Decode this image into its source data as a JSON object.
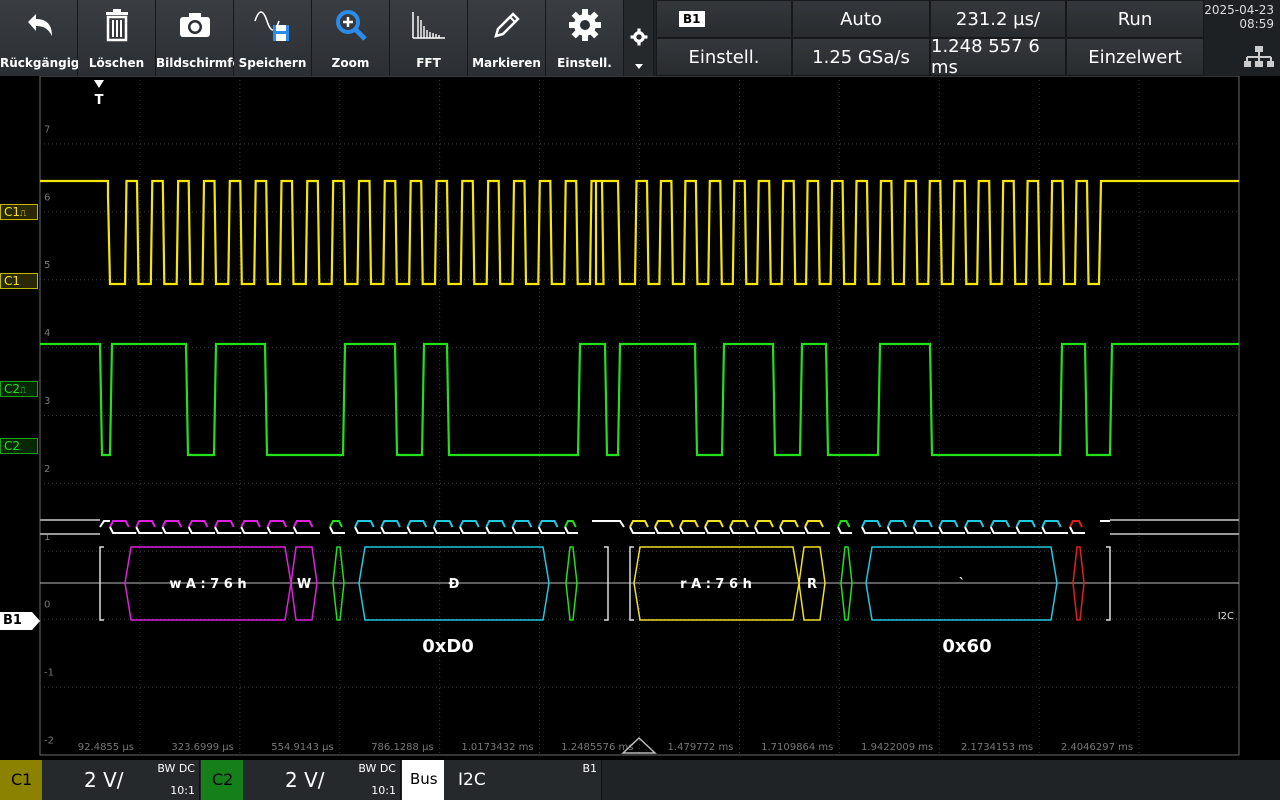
{
  "toolbar": {
    "buttons": [
      {
        "label": "Rückgängig",
        "icon": "undo-icon"
      },
      {
        "label": "Löschen",
        "icon": "trash-icon"
      },
      {
        "label": "Bildschirmfoto",
        "icon": "camera-icon"
      },
      {
        "label": "Speichern",
        "icon": "save-icon"
      },
      {
        "label": "Zoom",
        "icon": "zoom-icon"
      },
      {
        "label": "FFT",
        "icon": "fft-icon"
      },
      {
        "label": "Markieren",
        "icon": "pencil-icon"
      },
      {
        "label": "Einstell.",
        "icon": "gear-icon"
      }
    ],
    "settings_icon": "gear-small-icon"
  },
  "status": {
    "bus_badge": "B1",
    "bus_settings": "Einstell.",
    "trigger_mode": "Auto",
    "sample_rate": "1.25 GSa/s",
    "time_per_div": "231.2 µs/",
    "time_position": "1.248 557 6 ms",
    "run_state": "Run",
    "acq_mode": "Einzelwert",
    "date": "2025-04-23",
    "time": "08:59",
    "network_icon": "network-icon"
  },
  "grid": {
    "y_labels": [
      "7",
      "6",
      "5",
      "4",
      "3",
      "2",
      "1",
      "0",
      "-1",
      "-2"
    ],
    "x_labels": [
      "92.4855 µs",
      "323.6999 µs",
      "554.9143 µs",
      "786.1288 µs",
      "1.0173432 ms",
      "1.2485576 ms",
      "1.479772 ms",
      "1.7109864 ms",
      "1.9422009 ms",
      "2.1734153 ms",
      "2.4046297 ms"
    ],
    "trigger_marker": "T",
    "bus_protocol_tag": "I2C"
  },
  "channels": {
    "c1": {
      "label": "C1",
      "trig_label": "C1",
      "color": "#f5e60a"
    },
    "c2": {
      "label": "C2",
      "trig_label": "C2",
      "color": "#22e01a"
    },
    "b1": {
      "label": "B1"
    }
  },
  "decode": {
    "frames": [
      {
        "text": "w A : 7 6 h",
        "color": "#e020e0"
      },
      {
        "text": "W",
        "color": "#e020e0"
      },
      {
        "text": "Ð",
        "color": "#20c8e0"
      },
      {
        "text": "r A : 7 6 h",
        "color": "#f0e020"
      },
      {
        "text": "R",
        "color": "#f0e020"
      },
      {
        "text": "`",
        "color": "#20c8e0"
      }
    ],
    "hex_values": [
      "0xD0",
      "0x60"
    ]
  },
  "bottom": {
    "c1_label": "C1",
    "c1_scale": "2 V/",
    "c1_bw": "BW DC",
    "c1_probe": "10:1",
    "c2_label": "C2",
    "c2_scale": "2 V/",
    "c2_bw": "BW DC",
    "c2_probe": "10:1",
    "bus_label": "Bus",
    "bus_protocol": "I2C",
    "bus_id": "B1"
  }
}
